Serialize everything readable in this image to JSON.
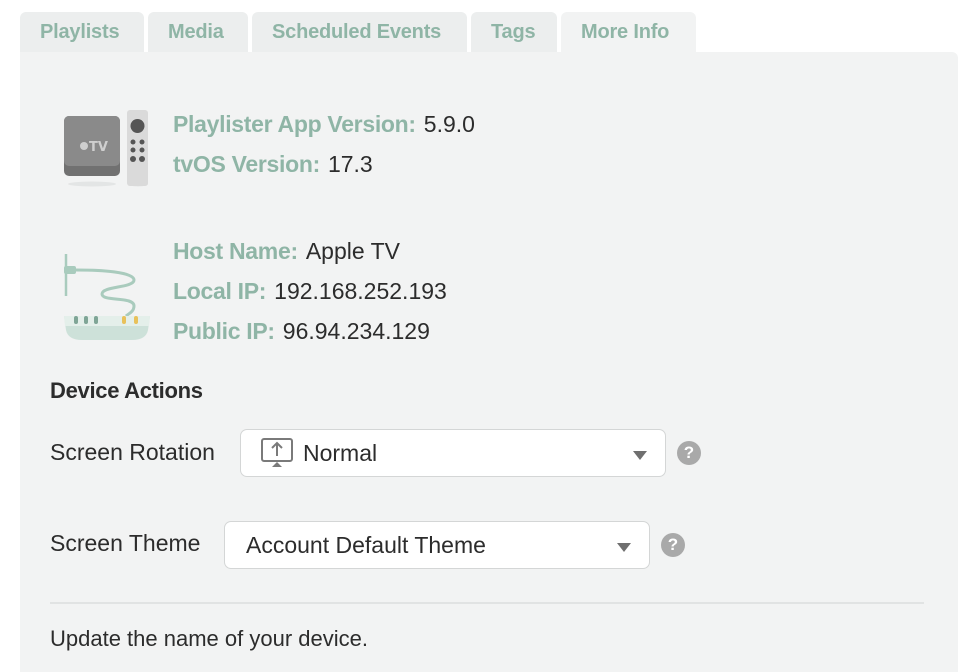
{
  "tabs": [
    {
      "label": "Playlists"
    },
    {
      "label": "Media"
    },
    {
      "label": "Scheduled Events"
    },
    {
      "label": "Tags"
    },
    {
      "label": "More Info",
      "active": true
    }
  ],
  "device_info": {
    "app_version": {
      "label": "Playlister App Version:",
      "value": "5.9.0"
    },
    "os_version": {
      "label": "tvOS Version:",
      "value": "17.3"
    },
    "device_icon_text": "TV"
  },
  "network_info": {
    "host_name": {
      "label": "Host Name:",
      "value": "Apple TV"
    },
    "local_ip": {
      "label": "Local IP:",
      "value": "192.168.252.193"
    },
    "public_ip": {
      "label": "Public IP:",
      "value": "96.94.234.129"
    }
  },
  "device_actions": {
    "title": "Device Actions",
    "screen_rotation": {
      "label": "Screen Rotation",
      "value": "Normal",
      "icon": "monitor-upload-icon"
    },
    "screen_theme": {
      "label": "Screen Theme",
      "value": "Account Default Theme"
    },
    "help_glyph": "?"
  },
  "update_name": {
    "text": "Update the name of your device."
  },
  "colors": {
    "accent": "#8fb5a6",
    "panel_bg": "#f2f3f3",
    "tab_bg": "#eceeee",
    "text": "#2c2c2c"
  }
}
